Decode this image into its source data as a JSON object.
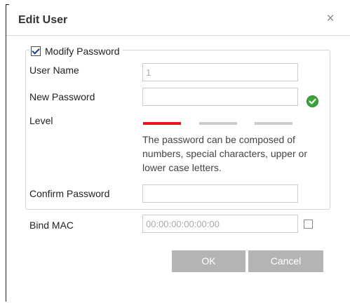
{
  "dialog": {
    "title": "Edit User",
    "close_symbol": "×"
  },
  "form": {
    "modify_password": {
      "label": "Modify Password",
      "checked": true
    },
    "user_name": {
      "label": "User Name",
      "value": "1"
    },
    "new_password": {
      "label": "New Password",
      "value": "",
      "status_icon": "check-circle-icon"
    },
    "level": {
      "label": "Level",
      "strength_colors": [
        "#e8161a",
        "#cccccc",
        "#cccccc"
      ]
    },
    "hint": "The password can be composed of numbers, special characters, upper or lower case letters.",
    "confirm_password": {
      "label": "Confirm Password",
      "value": ""
    },
    "bind_mac": {
      "label": "Bind MAC",
      "placeholder": "00:00:00:00:00:00",
      "checked": false
    }
  },
  "buttons": {
    "ok": "OK",
    "cancel": "Cancel"
  },
  "colors": {
    "button_bg": "#b4b4b4",
    "accent_green": "#3aa43a",
    "strength_red": "#e8161a"
  }
}
